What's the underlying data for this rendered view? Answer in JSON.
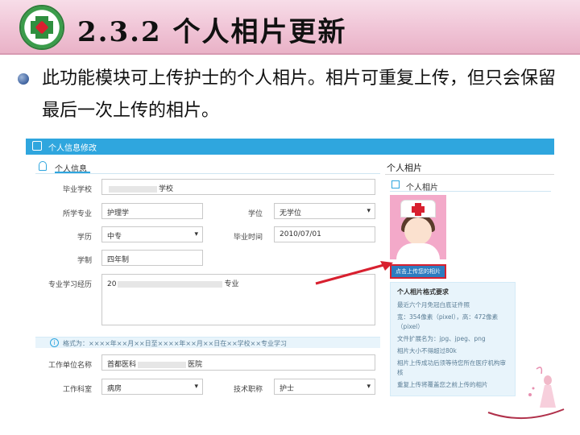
{
  "slide": {
    "title": "2.3.2 个人相片更新",
    "bullet": "此功能模块可上传护士的个人相片。相片可重复上传，但只会保留最后一次上传的相片。"
  },
  "panel": {
    "header_title": "个人信息修改",
    "section_title": "个人信息",
    "fields": {
      "school_label": "毕业学校",
      "school_value": "学校",
      "major_label": "所学专业",
      "major_value": "护理学",
      "degree_label": "学位",
      "degree_value": "无学位",
      "education_label": "学历",
      "education_value": "中专",
      "grad_time_label": "毕业时间",
      "grad_time_value": "2010/07/01",
      "system_label": "学制",
      "system_value": "四年制",
      "history_label": "专业学习经历",
      "history_prefix": "20",
      "history_suffix": "专业",
      "info_hint": "格式为：××××年××月××日至××××年××月××日在××学校××专业学习",
      "work_unit_label": "工作单位名称",
      "work_unit_prefix": "首都医科",
      "work_unit_suffix": "医院",
      "department_label": "工作科室",
      "department_value": "病房",
      "title_label": "技术职称",
      "title_value": "护士"
    },
    "photo": {
      "section_title": "个人相片",
      "subsection_title": "个人相片",
      "upload_button": "点击上传您的相片",
      "requirements_title": "个人相片格式要求",
      "requirements": [
        "最近六个月免冠白底证件照",
        "宽：354像素（pixel），高：472像素（pixel）",
        "文件扩展名为：jpg、jpeg、png",
        "相片大小不得超过80k",
        "相片上传成功后须等待您所在医疗机构审核",
        "重复上传将覆盖您之前上传的相片"
      ]
    }
  },
  "colors": {
    "accent": "#2fa6de",
    "title_bar": "#f0c4d6",
    "arrow": "#d8202f"
  }
}
